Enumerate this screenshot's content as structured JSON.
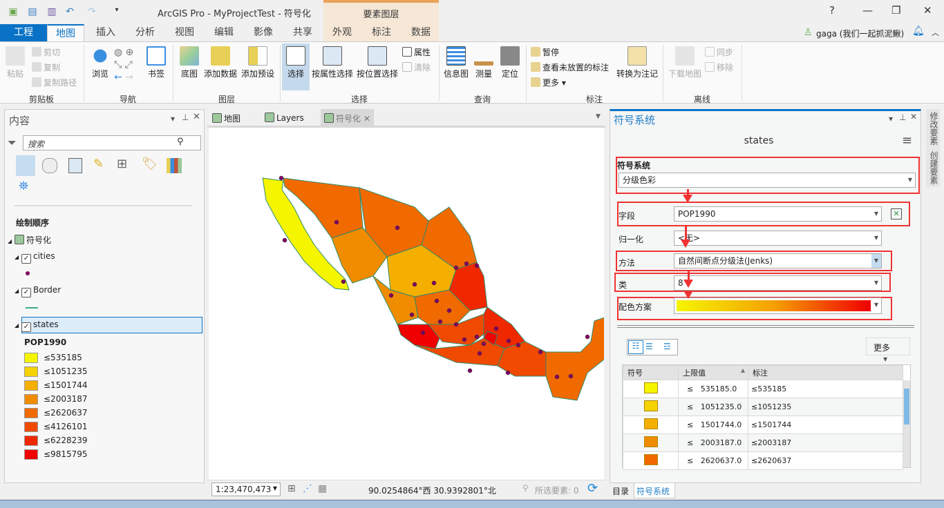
{
  "window": {
    "title": "ArcGIS Pro - MyProjectTest - 符号化",
    "context_group": "要素图层",
    "help": "?",
    "minimize": "—",
    "restore": "❐",
    "close": "✕"
  },
  "quick_access": [
    "new-project",
    "open-project",
    "save-project",
    "undo",
    "redo",
    "customize"
  ],
  "tabs": [
    "工程",
    "地图",
    "插入",
    "分析",
    "视图",
    "编辑",
    "影像",
    "共享",
    "外观",
    "标注",
    "数据"
  ],
  "active_tab": "地图",
  "user": {
    "name": "gaga (我们一起抓泥鳅)"
  },
  "ribbon": {
    "clipboard": {
      "label": "剪贴板",
      "paste": "粘贴",
      "cut": "剪切",
      "copy": "复制",
      "copy_path": "复制路径"
    },
    "navigate": {
      "label": "导航",
      "explore": "浏览",
      "bookmarks": "书签"
    },
    "layer": {
      "label": "图层",
      "basemap": "底图",
      "add_data": "添加数据",
      "add_preset": "添加预设"
    },
    "selection": {
      "label": "选择",
      "select": "选择",
      "by_attr": "按属性选择",
      "by_loc": "按位置选择",
      "attributes": "属性",
      "clear": "清除"
    },
    "inquiry": {
      "label": "查询",
      "infographics": "信息图",
      "measure": "测量",
      "locate": "定位"
    },
    "labeling": {
      "label": "标注",
      "pause": "暂停",
      "view_unplaced": "查看未放置的标注",
      "more": "更多",
      "convert": "转换为注记"
    },
    "offline": {
      "label": "离线",
      "download": "下载地图",
      "sync": "同步",
      "remove": "移除"
    }
  },
  "contents": {
    "title": "内容",
    "search_placeholder": "搜索",
    "drawing_order": "绘制顺序",
    "map_name": "符号化",
    "layers": [
      {
        "name": "cities",
        "checked": true
      },
      {
        "name": "Border",
        "checked": true
      },
      {
        "name": "states",
        "checked": true,
        "selected": true
      }
    ],
    "field": "POP1990",
    "legend": [
      {
        "label": "≤535185",
        "color": "#f5f500"
      },
      {
        "label": "≤1051235",
        "color": "#f5d200"
      },
      {
        "label": "≤1501744",
        "color": "#f5af00"
      },
      {
        "label": "≤2003187",
        "color": "#f08c00"
      },
      {
        "label": "≤2620637",
        "color": "#f06a00"
      },
      {
        "label": "≤4126101",
        "color": "#f04a00"
      },
      {
        "label": "≤6228239",
        "color": "#f02800"
      },
      {
        "label": "≤9815795",
        "color": "#f00000"
      }
    ]
  },
  "map_tabs": [
    {
      "label": "地图",
      "active": false
    },
    {
      "label": "Layers",
      "active": false
    },
    {
      "label": "符号化",
      "active": true
    }
  ],
  "status": {
    "scale": "1:23,470,473",
    "coords": "90.0254864°西 30.9392801°北",
    "selected": "所选要素: 0"
  },
  "symbology": {
    "title": "符号系统",
    "layer": "states",
    "section": "符号系统",
    "renderer": "分级色彩",
    "field_label": "字段",
    "field": "POP1990",
    "normalization_label": "归一化",
    "normalization": "<无>",
    "method_label": "方法",
    "method": "自然间断点分级法(Jenks)",
    "classes_label": "类",
    "classes": "8",
    "color_scheme_label": "配色方案",
    "color_scheme": [
      "#f5f500",
      "#f5a000",
      "#f00000"
    ],
    "more": "更多",
    "columns": [
      "符号",
      "上限值",
      "标注"
    ],
    "rows": [
      {
        "upper": "≤   535185.0",
        "label": "≤535185",
        "color": "#f5f500"
      },
      {
        "upper": "≤   1051235.0",
        "label": "≤1051235",
        "color": "#f5d200"
      },
      {
        "upper": "≤   1501744.0",
        "label": "≤1501744",
        "color": "#f5af00"
      },
      {
        "upper": "≤   2003187.0",
        "label": "≤2003187",
        "color": "#f08c00"
      },
      {
        "upper": "≤   2620637.0",
        "label": "≤2620637",
        "color": "#f06a00"
      }
    ],
    "bottom_tabs": [
      "目录",
      "符号系统"
    ]
  },
  "side_tabs": [
    "修改要素",
    "创建要素"
  ]
}
